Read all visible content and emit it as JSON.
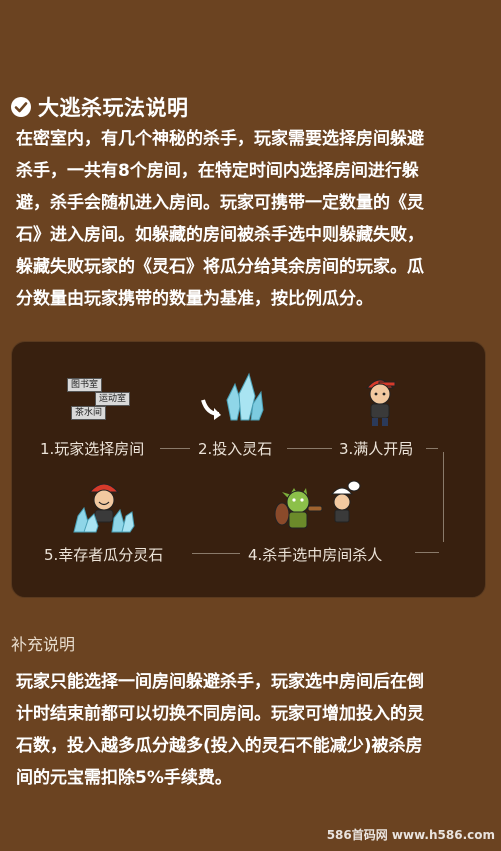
{
  "title": {
    "text": "大逃杀玩法说明",
    "icon": "check-badge-icon"
  },
  "intro_lines": [
    "在密室内，有几个神秘的杀手，玩家需要选择房间躲避",
    "杀手，一共有8个房间，在特定时间内选择房间进行躲",
    "避，杀手会随机进入房间。玩家可携带一定数量的《灵",
    "石》进入房间。如躲藏的房间被杀手选中则躲藏失败，",
    "躲藏失败玩家的《灵石》将瓜分给其余房间的玩家。瓜",
    "分数量由玩家携带的数量为基准，按比例瓜分。"
  ],
  "flow": {
    "room_tags": [
      "图书室",
      "运动室",
      "茶水间"
    ],
    "steps": [
      {
        "label": "1.玩家选择房间",
        "icon": "room-signs-icon"
      },
      {
        "label": "2.投入灵石",
        "icon": "spirit-stone-icon"
      },
      {
        "label": "3.满人开局",
        "icon": "player-character-icon"
      },
      {
        "label": "4.杀手选中房间杀人",
        "icon": "goblin-killer-icon"
      },
      {
        "label": "5.幸存者瓜分灵石",
        "icon": "survivor-with-stones-icon"
      }
    ]
  },
  "supplement": {
    "title": "补充说明",
    "lines": [
      "玩家只能选择一间房间躲避杀手，玩家选中房间后在倒",
      "计时结束前都可以切换不同房间。玩家可增加投入的灵",
      "石数，投入越多瓜分越多(投入的灵石不能减少)被杀房",
      "间的元宝需扣除5%手续费。"
    ]
  },
  "watermark": "586首码网 www.h586.com",
  "colors": {
    "background": "#6b4321",
    "panel": "#38200f",
    "text": "#ffffff",
    "stone": "#8fd6e8"
  }
}
